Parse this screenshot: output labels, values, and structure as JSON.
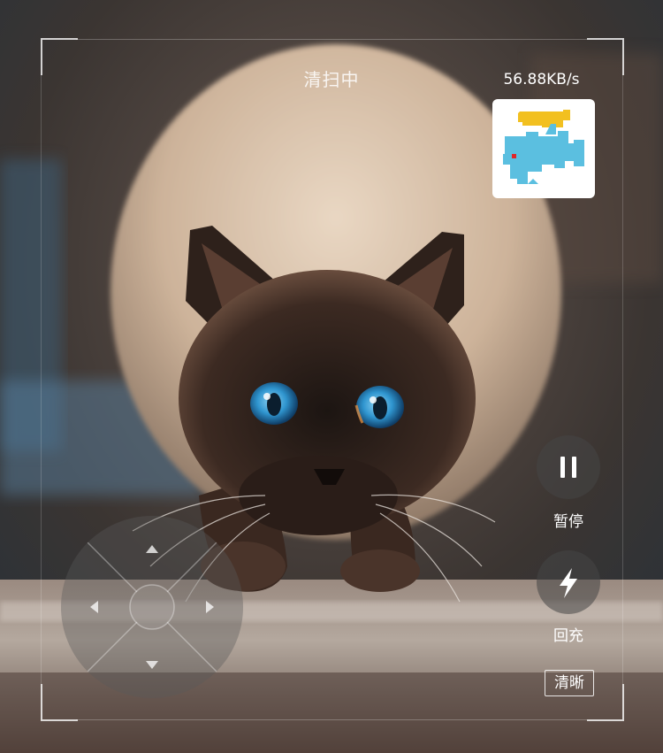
{
  "header": {
    "status_text": "清扫中",
    "speed_text": "56.88KB/s"
  },
  "controls": {
    "pause_label": "暂停",
    "charge_label": "回充",
    "quality_label": "清晰"
  },
  "colors": {
    "map_room_primary": "#5bbfe0",
    "map_room_secondary": "#f2c020",
    "map_robot_marker": "#e0262a"
  },
  "icons": [
    "pause-icon",
    "lightning-icon",
    "arrow-up-icon",
    "arrow-down-icon",
    "arrow-left-icon",
    "arrow-right-icon"
  ]
}
